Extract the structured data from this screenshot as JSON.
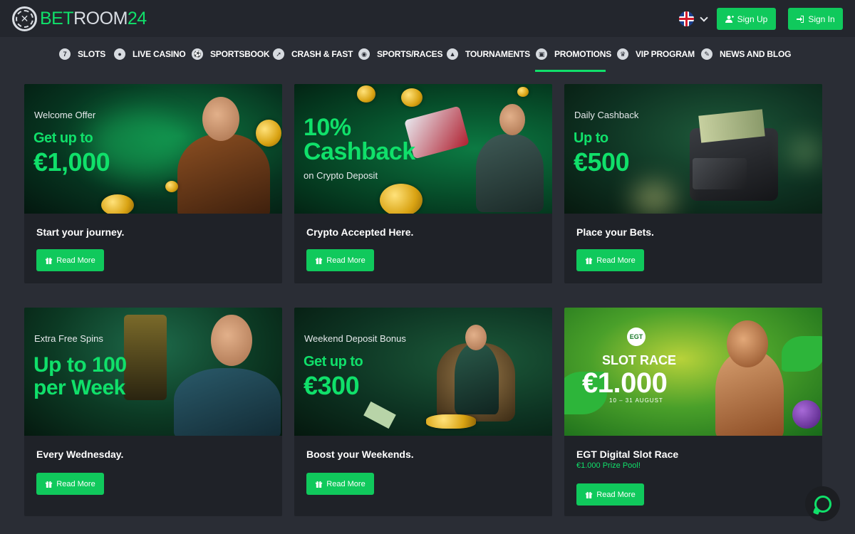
{
  "header": {
    "logo": {
      "bet": "BET",
      "room": "ROOM",
      "num": "24"
    },
    "language_flag": "uk-flag-icon",
    "signup_label": "Sign Up",
    "signin_label": "Sign In"
  },
  "nav": {
    "active": "PROMOTIONS",
    "items": [
      {
        "label": "SLOTS",
        "icon": "slots-icon"
      },
      {
        "label": "LIVE CASINO",
        "icon": "live-casino-icon"
      },
      {
        "label": "SPORTSBOOK",
        "icon": "sportsbook-icon"
      },
      {
        "label": "CRASH & FAST",
        "icon": "crash-fast-icon"
      },
      {
        "label": "SPORTS/RACES",
        "icon": "sports-races-icon"
      },
      {
        "label": "TOURNAMENTS",
        "icon": "tournaments-icon"
      },
      {
        "label": "PROMOTIONS",
        "icon": "gift-icon"
      },
      {
        "label": "VIP PROGRAM",
        "icon": "crown-icon"
      },
      {
        "label": "NEWS AND BLOG",
        "icon": "news-icon"
      }
    ]
  },
  "promotions": [
    {
      "kicker": "Welcome Offer",
      "headline_1": "Get up to",
      "headline_2": "€1,000",
      "title": "Start your journey.",
      "button": "Read More"
    },
    {
      "headline_1": "10%",
      "headline_2": "Cashback",
      "subline": "on Crypto Deposit",
      "title": "Crypto Accepted Here.",
      "button": "Read More"
    },
    {
      "kicker": "Daily Cashback",
      "headline_1": "Up to",
      "headline_2": "€500",
      "title": "Place your Bets.",
      "button": "Read More"
    },
    {
      "kicker": "Extra Free Spins",
      "headline_1": "Up to 100",
      "headline_2": "per Week",
      "title": "Every Wednesday.",
      "button": "Read More"
    },
    {
      "kicker": "Weekend Deposit Bonus",
      "headline_1": "Get up to",
      "headline_2": "€300",
      "title": "Boost your Weekends.",
      "button": "Read More"
    },
    {
      "badge": "EGT",
      "headline_1": "SLOT RACE",
      "headline_2": "€1.000",
      "dates": "10 – 31 AUGUST",
      "title": "EGT Digital Slot Race",
      "subtitle": "€1.000 Prize Pool!",
      "button": "Read More"
    }
  ],
  "colors": {
    "accent": "#10e06a",
    "button": "#10c95c",
    "page_bg": "#2a2d35",
    "card_bg": "#1f2228",
    "header_bg": "#23262d"
  }
}
